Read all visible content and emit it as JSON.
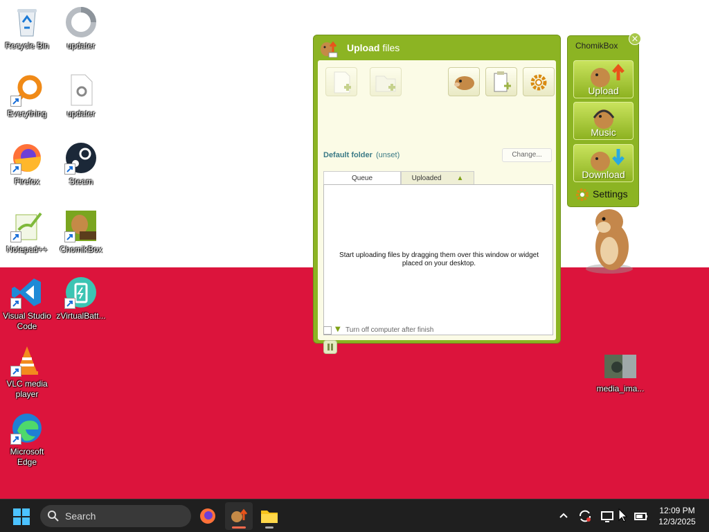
{
  "desktop": {
    "icons": [
      {
        "label": "Recycle Bin"
      },
      {
        "label": "updater"
      },
      {
        "label": "Everything"
      },
      {
        "label": "updater"
      },
      {
        "label": "Firefox"
      },
      {
        "label": "Steam"
      },
      {
        "label": "Notepad++"
      },
      {
        "label": "ChomikBox"
      },
      {
        "label": "Visual Studio Code"
      },
      {
        "label": "zVirtualBatt..."
      },
      {
        "label": "VLC media player"
      },
      {
        "label": "Microsoft Edge"
      },
      {
        "label": "media_ima..."
      }
    ]
  },
  "upload_window": {
    "title_bold": "Upload",
    "title_rest": " files",
    "default_folder_label": "Default folder",
    "default_folder_value": "(unset)",
    "change_label": "Change...",
    "tabs": [
      "Queue",
      "Uploaded"
    ],
    "queue_message": "Start uploading files by dragging them over this window or widget placed on your desktop.",
    "turn_off_label": "Turn off computer after finish"
  },
  "widget": {
    "title": "ChomikBox",
    "buttons": [
      "Upload",
      "Music",
      "Download"
    ],
    "settings_label": "Settings",
    "close_glyph": "×"
  },
  "taskbar": {
    "search_placeholder": "Search",
    "time": "12:09 PM",
    "date": "12/3/2025"
  },
  "colors": {
    "flag_white": "#ffffff",
    "flag_red": "#dc143c",
    "chomik_green": "#8cb423",
    "taskbar": "#1f1f1f"
  }
}
